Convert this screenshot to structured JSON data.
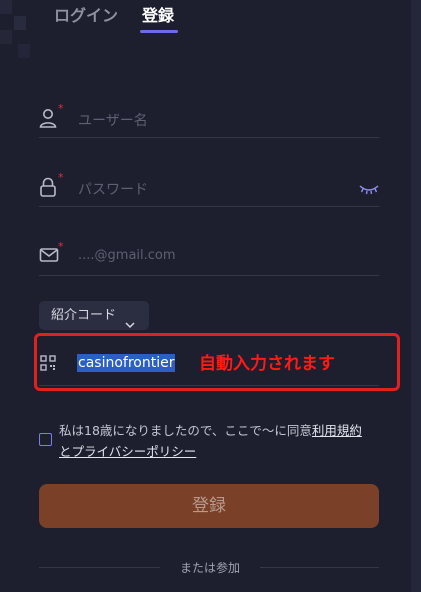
{
  "tabs": [
    {
      "label": "ログイン",
      "active": false
    },
    {
      "label": "登録",
      "active": true
    }
  ],
  "form": {
    "username": {
      "placeholder": "ユーザー名",
      "icon": "user-icon",
      "required": "*"
    },
    "password": {
      "placeholder": "パスワード",
      "icon": "lock-icon",
      "required": "*",
      "toggle_icon": "eye-closed-icon"
    },
    "email": {
      "placeholder": "....@gmail.com",
      "icon": "mail-icon",
      "required": "*"
    },
    "referral_toggle": {
      "label": "紹介コード",
      "icon": "chevron-down-icon"
    },
    "referral_code": {
      "value": "casinofrontier",
      "icon": "qr-code-icon"
    },
    "annotation": "自動入力されます",
    "agreement": {
      "prefix": "私は18歳になりましたので、ここで～に同意",
      "terms_link": "利用規約",
      "connector": "と",
      "privacy_link": "プライバシーポリシー",
      "checked": false
    },
    "submit_label": "登録",
    "or_join": "または参加"
  },
  "colors": {
    "background": "#1d1f2f",
    "accent": "#6d6af0",
    "submit_bg": "#7a4128",
    "required": "#e0303a",
    "annotation": "#ff1a14"
  }
}
